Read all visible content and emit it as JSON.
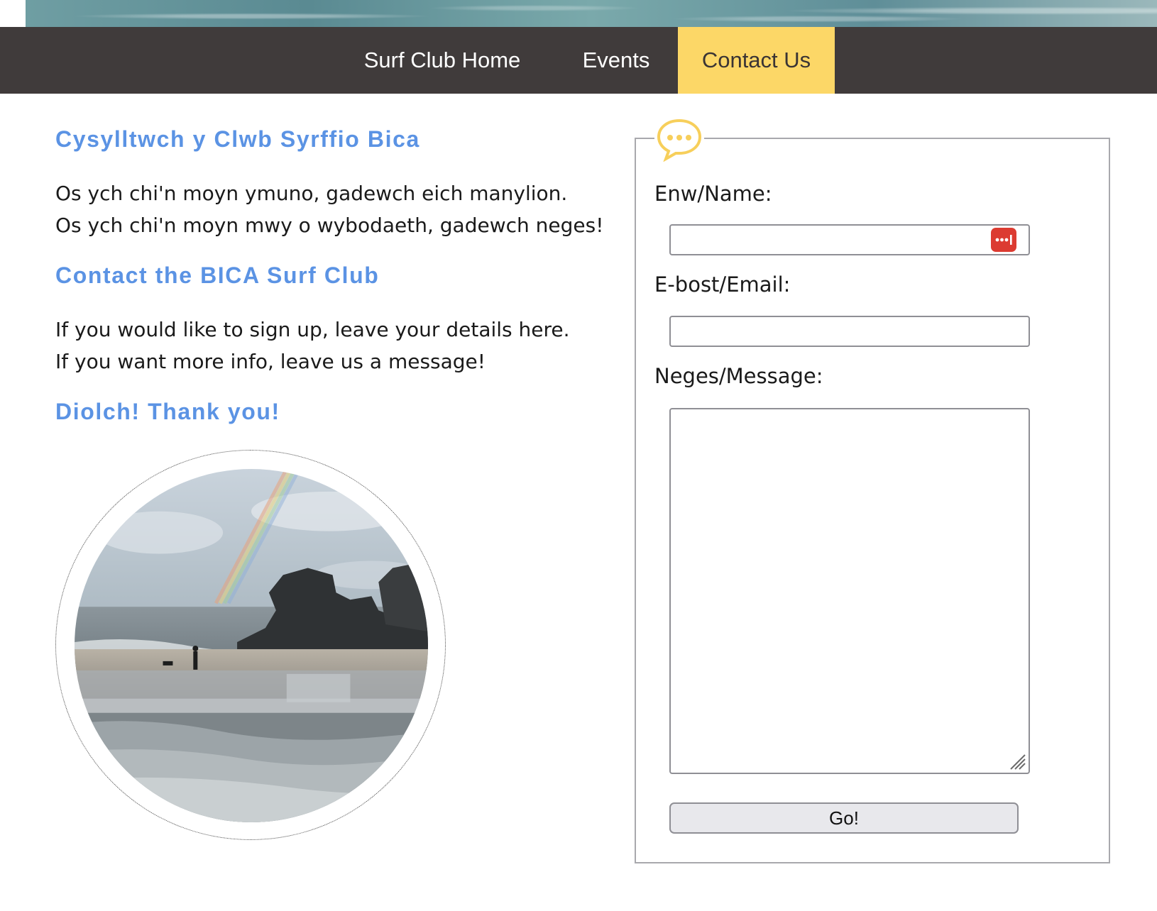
{
  "nav": {
    "items": [
      {
        "label": "Surf Club Home",
        "active": false
      },
      {
        "label": "Events",
        "active": false
      },
      {
        "label": "Contact Us",
        "active": true
      }
    ]
  },
  "content": {
    "welsh_heading": "Cysylltwch y Clwb Syrffio Bica",
    "welsh_lines": [
      "Os ych chi'n moyn ymuno, gadewch eich manylion.",
      "Os ych chi'n moyn mwy o wybodaeth, gadewch neges!"
    ],
    "english_heading": "Contact the BICA Surf Club",
    "english_lines": [
      "If you would like to sign up, leave your details here.",
      "If you want more info, leave us a message!"
    ],
    "thanks_heading": "Diolch! Thank you!"
  },
  "form": {
    "name_label": "Enw/Name:",
    "name_value": "",
    "email_label": "E-bost/Email:",
    "email_value": "",
    "message_label": "Neges/Message:",
    "message_value": "",
    "submit_label": "Go!"
  },
  "icons": {
    "chat_bubble": "chat-bubble-icon",
    "password_manager": "password-manager-icon",
    "resize_grip": "resize-grip-icon"
  },
  "colors": {
    "nav_background": "#403b3b",
    "nav_active": "#fcd767",
    "heading_blue": "#5b93e4",
    "pw_icon_red": "#dc3b31"
  }
}
